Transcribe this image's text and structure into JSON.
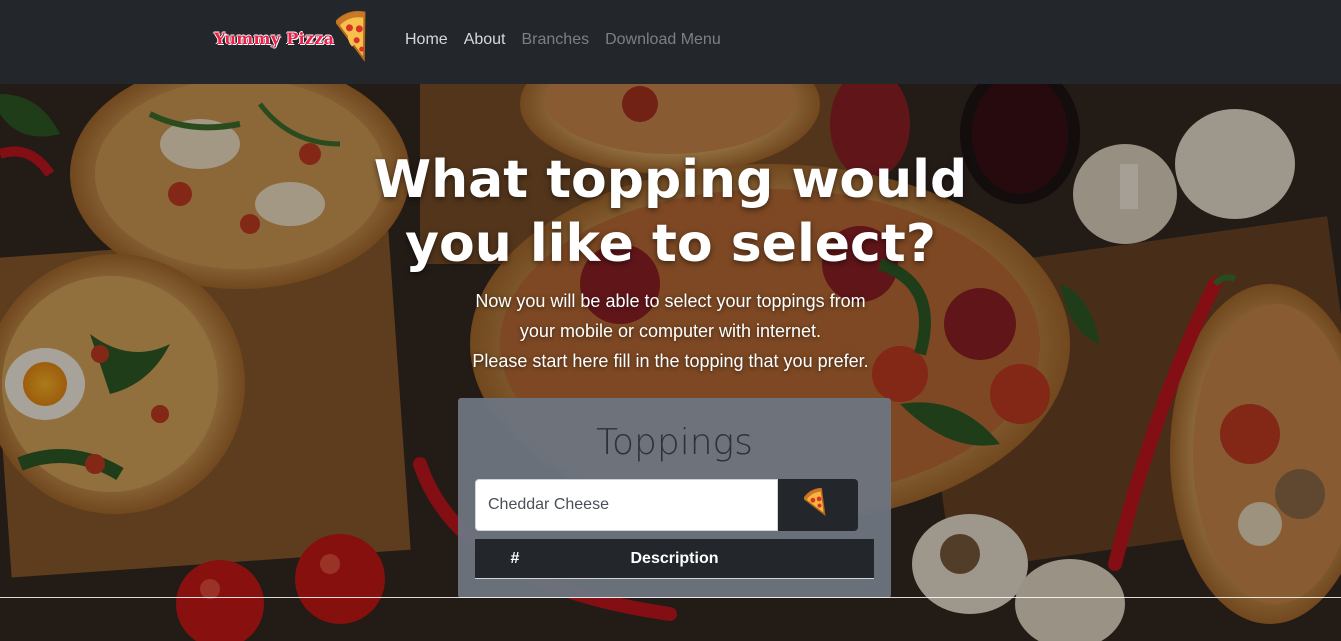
{
  "navbar": {
    "brand": "Yummy Pizza",
    "brand_icon": "pizza-slice-icon",
    "links": [
      {
        "label": "Home",
        "state": "active"
      },
      {
        "label": "About",
        "state": "active"
      },
      {
        "label": "Branches",
        "state": "muted"
      },
      {
        "label": "Download Menu",
        "state": "muted"
      }
    ]
  },
  "hero": {
    "title_line1": "What topping would",
    "title_line2": "you like to select?",
    "sub_line1": "Now you will be able to select your toppings from",
    "sub_line2": "your mobile or computer with internet.",
    "sub_line3": "Please start here fill in the topping that you prefer."
  },
  "toppings": {
    "title": "Toppings",
    "input_value": "Cheddar Cheese",
    "add_button_icon": "pizza-slice-icon",
    "table_headers": {
      "number": "#",
      "description": "Description"
    }
  },
  "colors": {
    "navbar_bg": "#23262b",
    "brand_red": "#e8204a",
    "card_bg": "#6c747f",
    "table_header_bg": "#23262b"
  }
}
